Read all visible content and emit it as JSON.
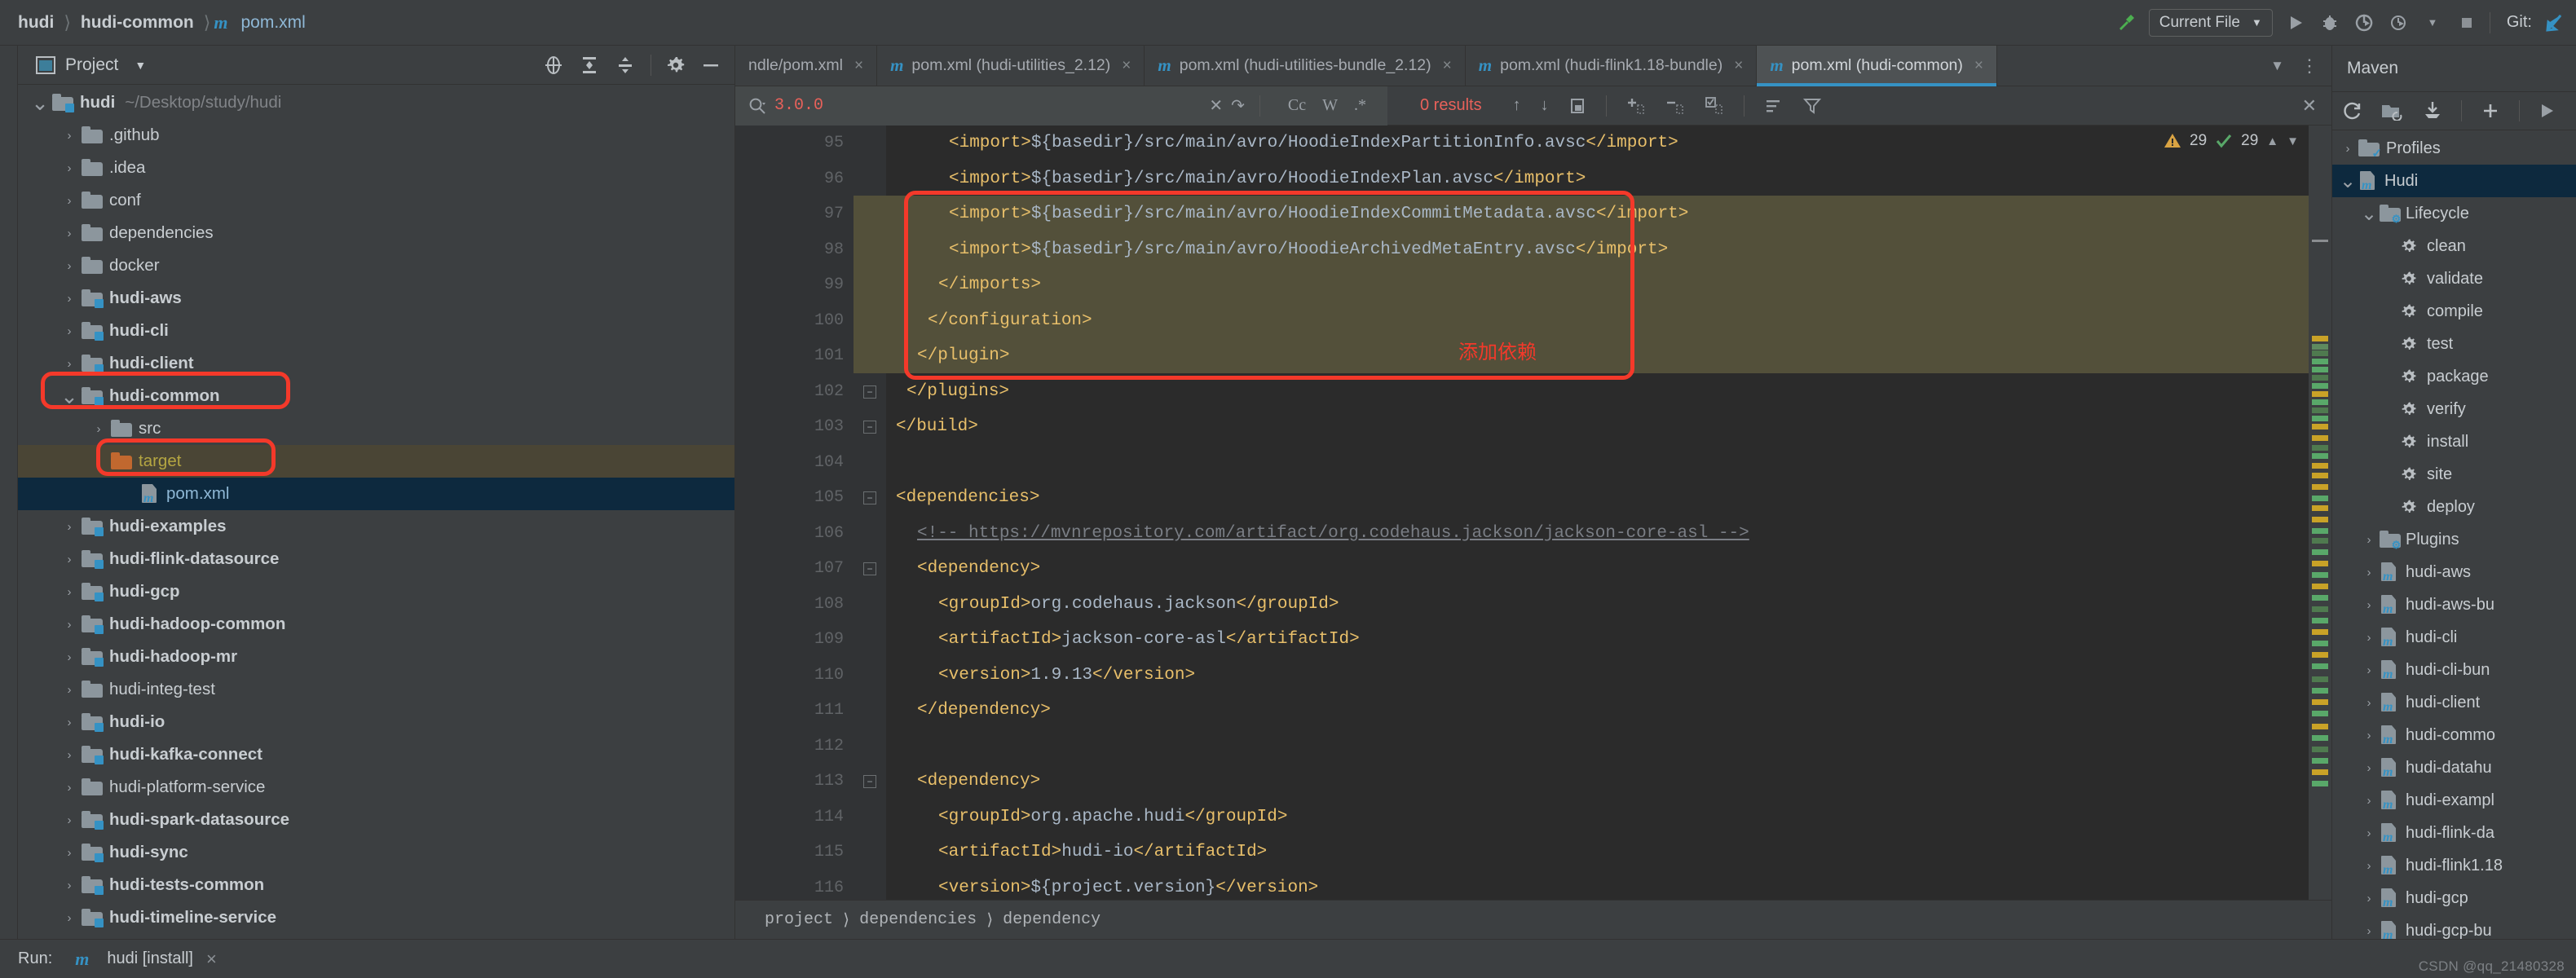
{
  "topbar": {
    "breadcrumb": [
      "hudi",
      "hudi-common",
      "pom.xml"
    ],
    "run_config": "Current File",
    "git_label": "Git:",
    "icons": [
      "hammer-icon",
      "run-icon",
      "debug-icon",
      "run-with-coverage-icon",
      "profile-icon",
      "stop-icon",
      "git-update-icon"
    ]
  },
  "project_panel": {
    "title": "Project",
    "header_icons": [
      "locate-icon",
      "expand-all-icon",
      "collapse-all-icon",
      "gear-icon",
      "minimize-icon"
    ],
    "tree": [
      {
        "label": "hudi",
        "path": "~/Desktop/study/hudi",
        "indent": 0,
        "arrow": "v",
        "icon": "module-folder-icon",
        "bold": true
      },
      {
        "label": ".github",
        "indent": 1,
        "arrow": ">",
        "icon": "folder-icon"
      },
      {
        "label": ".idea",
        "indent": 1,
        "arrow": ">",
        "icon": "folder-icon"
      },
      {
        "label": "conf",
        "indent": 1,
        "arrow": ">",
        "icon": "folder-icon"
      },
      {
        "label": "dependencies",
        "indent": 1,
        "arrow": ">",
        "icon": "folder-icon"
      },
      {
        "label": "docker",
        "indent": 1,
        "arrow": ">",
        "icon": "folder-icon"
      },
      {
        "label": "hudi-aws",
        "indent": 1,
        "arrow": ">",
        "icon": "module-folder-icon",
        "bold": true
      },
      {
        "label": "hudi-cli",
        "indent": 1,
        "arrow": ">",
        "icon": "module-folder-icon",
        "bold": true
      },
      {
        "label": "hudi-client",
        "indent": 1,
        "arrow": ">",
        "icon": "module-folder-icon",
        "bold": true
      },
      {
        "label": "hudi-common",
        "indent": 1,
        "arrow": "v",
        "icon": "module-folder-icon",
        "bold": true,
        "annotated": true
      },
      {
        "label": "src",
        "indent": 2,
        "arrow": ">",
        "icon": "folder-icon"
      },
      {
        "label": "target",
        "indent": 2,
        "arrow": ">",
        "icon": "target-folder-icon",
        "state": "target"
      },
      {
        "label": "pom.xml",
        "indent": 3,
        "arrow": "",
        "icon": "maven-file-icon",
        "state": "selected",
        "annotated": true
      },
      {
        "label": "hudi-examples",
        "indent": 1,
        "arrow": ">",
        "icon": "module-folder-icon",
        "bold": true
      },
      {
        "label": "hudi-flink-datasource",
        "indent": 1,
        "arrow": ">",
        "icon": "module-folder-icon",
        "bold": true
      },
      {
        "label": "hudi-gcp",
        "indent": 1,
        "arrow": ">",
        "icon": "module-folder-icon",
        "bold": true
      },
      {
        "label": "hudi-hadoop-common",
        "indent": 1,
        "arrow": ">",
        "icon": "module-folder-icon",
        "bold": true
      },
      {
        "label": "hudi-hadoop-mr",
        "indent": 1,
        "arrow": ">",
        "icon": "module-folder-icon",
        "bold": true
      },
      {
        "label": "hudi-integ-test",
        "indent": 1,
        "arrow": ">",
        "icon": "folder-icon"
      },
      {
        "label": "hudi-io",
        "indent": 1,
        "arrow": ">",
        "icon": "module-folder-icon",
        "bold": true
      },
      {
        "label": "hudi-kafka-connect",
        "indent": 1,
        "arrow": ">",
        "icon": "module-folder-icon",
        "bold": true
      },
      {
        "label": "hudi-platform-service",
        "indent": 1,
        "arrow": ">",
        "icon": "folder-icon"
      },
      {
        "label": "hudi-spark-datasource",
        "indent": 1,
        "arrow": ">",
        "icon": "module-folder-icon",
        "bold": true
      },
      {
        "label": "hudi-sync",
        "indent": 1,
        "arrow": ">",
        "icon": "module-folder-icon",
        "bold": true
      },
      {
        "label": "hudi-tests-common",
        "indent": 1,
        "arrow": ">",
        "icon": "module-folder-icon",
        "bold": true
      },
      {
        "label": "hudi-timeline-service",
        "indent": 1,
        "arrow": ">",
        "icon": "module-folder-icon",
        "bold": true
      }
    ]
  },
  "editor": {
    "tabs": [
      {
        "label": "ndle/pom.xml",
        "active": false,
        "clipped": true,
        "show_icon": false
      },
      {
        "label": "pom.xml (hudi-utilities_2.12)",
        "active": false
      },
      {
        "label": "pom.xml (hudi-utilities-bundle_2.12)",
        "active": false
      },
      {
        "label": "pom.xml (hudi-flink1.18-bundle)",
        "active": false
      },
      {
        "label": "pom.xml (hudi-common)",
        "active": true
      }
    ],
    "tab_close_glyph": "×",
    "tabbar_icons": [
      "chevron-down-icon",
      "more-options-icon"
    ],
    "search": {
      "query": "3.0.0",
      "results": "0 results",
      "toggles": [
        "Cc",
        "W",
        ".*"
      ],
      "icons": [
        "search-icon",
        "clear-icon",
        "regex-history-icon",
        "prev-match-icon",
        "next-match-icon",
        "select-all-icon",
        "add-icon",
        "remove-icon",
        "toggle-icon",
        "filter-icon",
        "close-search-icon"
      ]
    },
    "inspections": {
      "warnings": "29",
      "checks": "29"
    },
    "code": [
      {
        "num": "95",
        "indent": 9,
        "parts": [
          {
            "t": "tag",
            "v": "<import>"
          },
          {
            "t": "txt",
            "v": "${basedir}/src/main/avro/HoodieIndexPartitionInfo.avsc"
          },
          {
            "t": "tag",
            "v": "</import>"
          }
        ]
      },
      {
        "num": "96",
        "indent": 9,
        "parts": [
          {
            "t": "tag",
            "v": "<import>"
          },
          {
            "t": "txt",
            "v": "${basedir}/src/main/avro/HoodieIndexPlan.avsc"
          },
          {
            "t": "tag",
            "v": "</import>"
          }
        ]
      },
      {
        "num": "97",
        "indent": 9,
        "parts": [
          {
            "t": "tag",
            "v": "<import>"
          },
          {
            "t": "txt",
            "v": "${basedir}/src/main/avro/HoodieIndexCommitMetadata.avsc"
          },
          {
            "t": "tag",
            "v": "</import>"
          }
        ]
      },
      {
        "num": "98",
        "indent": 9,
        "parts": [
          {
            "t": "tag",
            "v": "<import>"
          },
          {
            "t": "txt",
            "v": "${basedir}/src/main/avro/HoodieArchivedMetaEntry.avsc"
          },
          {
            "t": "tag",
            "v": "</import>"
          }
        ]
      },
      {
        "num": "99",
        "indent": 8,
        "fold": true,
        "parts": [
          {
            "t": "tag",
            "v": "</imports>"
          }
        ]
      },
      {
        "num": "100",
        "indent": 7,
        "fold": true,
        "parts": [
          {
            "t": "tag",
            "v": "</configuration>"
          }
        ]
      },
      {
        "num": "101",
        "indent": 6,
        "fold": true,
        "parts": [
          {
            "t": "tag",
            "v": "</plugin>"
          }
        ]
      },
      {
        "num": "102",
        "indent": 5,
        "fold": true,
        "parts": [
          {
            "t": "tag",
            "v": "</plugins>"
          }
        ]
      },
      {
        "num": "103",
        "indent": 4,
        "fold": true,
        "parts": [
          {
            "t": "tag",
            "v": "</build>"
          }
        ]
      },
      {
        "num": "104",
        "indent": 0,
        "parts": []
      },
      {
        "num": "105",
        "indent": 4,
        "fold": true,
        "parts": [
          {
            "t": "tag",
            "v": "<dependencies>"
          }
        ]
      },
      {
        "num": "106",
        "indent": 6,
        "parts": [
          {
            "t": "cmt",
            "v": "<!-- https://mvnrepository.com/artifact/org.codehaus.jackson/jackson-core-asl -->"
          }
        ]
      },
      {
        "num": "107",
        "indent": 6,
        "fold": true,
        "hl": true,
        "parts": [
          {
            "t": "tag",
            "v": "<dependency>"
          }
        ]
      },
      {
        "num": "108",
        "indent": 8,
        "hl": true,
        "parts": [
          {
            "t": "tag",
            "v": "<groupId>"
          },
          {
            "t": "txt",
            "v": "org.codehaus.jackson"
          },
          {
            "t": "tag",
            "v": "</groupId>"
          }
        ]
      },
      {
        "num": "109",
        "indent": 8,
        "hl": true,
        "parts": [
          {
            "t": "tag",
            "v": "<artifactId>"
          },
          {
            "t": "txt",
            "v": "jackson-core-asl"
          },
          {
            "t": "tag",
            "v": "</artifactId>"
          }
        ]
      },
      {
        "num": "110",
        "indent": 8,
        "hl": true,
        "parts": [
          {
            "t": "tag",
            "v": "<version>"
          },
          {
            "t": "txt",
            "v": "1.9.13"
          },
          {
            "t": "tag",
            "v": "</version>"
          }
        ]
      },
      {
        "num": "111",
        "indent": 6,
        "hl": true,
        "bulb": true,
        "parts": [
          {
            "t": "tag",
            "v": "</dependency>"
          }
        ]
      },
      {
        "num": "112",
        "indent": 0,
        "parts": []
      },
      {
        "num": "113",
        "indent": 6,
        "fold": true,
        "parts": [
          {
            "t": "tag",
            "v": "<dependency>"
          }
        ]
      },
      {
        "num": "114",
        "indent": 8,
        "parts": [
          {
            "t": "tag",
            "v": "<groupId>"
          },
          {
            "t": "txt",
            "v": "org.apache.hudi"
          },
          {
            "t": "tag",
            "v": "</groupId>"
          }
        ]
      },
      {
        "num": "115",
        "indent": 8,
        "parts": [
          {
            "t": "tag",
            "v": "<artifactId>"
          },
          {
            "t": "txt",
            "v": "hudi-io"
          },
          {
            "t": "tag",
            "v": "</artifactId>"
          }
        ]
      },
      {
        "num": "116",
        "indent": 8,
        "parts": [
          {
            "t": "tag",
            "v": "<version>"
          },
          {
            "t": "txt",
            "v": "${project.version}"
          },
          {
            "t": "tag",
            "v": "</version>"
          }
        ]
      }
    ],
    "annotation_label": "添加依赖",
    "breadcrumb": [
      "project",
      "dependencies",
      "dependency"
    ]
  },
  "maven_panel": {
    "title": "Maven",
    "toolbar_icons": [
      "reload-icon",
      "add-maven-project-icon",
      "download-sources-icon",
      "add-icon",
      "run-icon"
    ],
    "tree": [
      {
        "label": "Profiles",
        "indent": 0,
        "arrow": ">",
        "icon": "profiles-icon"
      },
      {
        "label": "Hudi",
        "indent": 0,
        "arrow": "v",
        "icon": "maven-project-icon",
        "state": "selected"
      },
      {
        "label": "Lifecycle",
        "indent": 1,
        "arrow": "v",
        "icon": "lifecycle-folder-icon"
      },
      {
        "label": "clean",
        "indent": 2,
        "arrow": "",
        "icon": "gear-icon"
      },
      {
        "label": "validate",
        "indent": 2,
        "arrow": "",
        "icon": "gear-icon"
      },
      {
        "label": "compile",
        "indent": 2,
        "arrow": "",
        "icon": "gear-icon"
      },
      {
        "label": "test",
        "indent": 2,
        "arrow": "",
        "icon": "gear-icon"
      },
      {
        "label": "package",
        "indent": 2,
        "arrow": "",
        "icon": "gear-icon"
      },
      {
        "label": "verify",
        "indent": 2,
        "arrow": "",
        "icon": "gear-icon"
      },
      {
        "label": "install",
        "indent": 2,
        "arrow": "",
        "icon": "gear-icon"
      },
      {
        "label": "site",
        "indent": 2,
        "arrow": "",
        "icon": "gear-icon"
      },
      {
        "label": "deploy",
        "indent": 2,
        "arrow": "",
        "icon": "gear-icon"
      },
      {
        "label": "Plugins",
        "indent": 1,
        "arrow": ">",
        "icon": "plugins-folder-icon"
      },
      {
        "label": "hudi-aws",
        "indent": 1,
        "arrow": ">",
        "icon": "maven-project-icon"
      },
      {
        "label": "hudi-aws-bu",
        "indent": 1,
        "arrow": ">",
        "icon": "maven-project-icon"
      },
      {
        "label": "hudi-cli",
        "indent": 1,
        "arrow": ">",
        "icon": "maven-project-icon"
      },
      {
        "label": "hudi-cli-bun",
        "indent": 1,
        "arrow": ">",
        "icon": "maven-project-icon"
      },
      {
        "label": "hudi-client",
        "indent": 1,
        "arrow": ">",
        "icon": "maven-project-icon"
      },
      {
        "label": "hudi-commo",
        "indent": 1,
        "arrow": ">",
        "icon": "maven-project-icon"
      },
      {
        "label": "hudi-datahu",
        "indent": 1,
        "arrow": ">",
        "icon": "maven-project-icon"
      },
      {
        "label": "hudi-exampl",
        "indent": 1,
        "arrow": ">",
        "icon": "maven-project-icon"
      },
      {
        "label": "hudi-flink-da",
        "indent": 1,
        "arrow": ">",
        "icon": "maven-project-icon"
      },
      {
        "label": "hudi-flink1.18",
        "indent": 1,
        "arrow": ">",
        "icon": "maven-project-icon"
      },
      {
        "label": "hudi-gcp",
        "indent": 1,
        "arrow": ">",
        "icon": "maven-project-icon"
      },
      {
        "label": "hudi-gcp-bu",
        "indent": 1,
        "arrow": ">",
        "icon": "maven-project-icon"
      }
    ]
  },
  "run_bar": {
    "label": "Run:",
    "session": "hudi [install]",
    "close_glyph": "×"
  },
  "watermark": "CSDN @qq_21480328",
  "colors": {
    "accent": "#3592c4",
    "annotation_red": "#f4392a",
    "selection_blue": "#0d293e",
    "highlight_olive": "#53503a",
    "target_brown": "#4a4535",
    "error_text": "#e8615a",
    "tag_yellow": "#e8bf6a"
  }
}
